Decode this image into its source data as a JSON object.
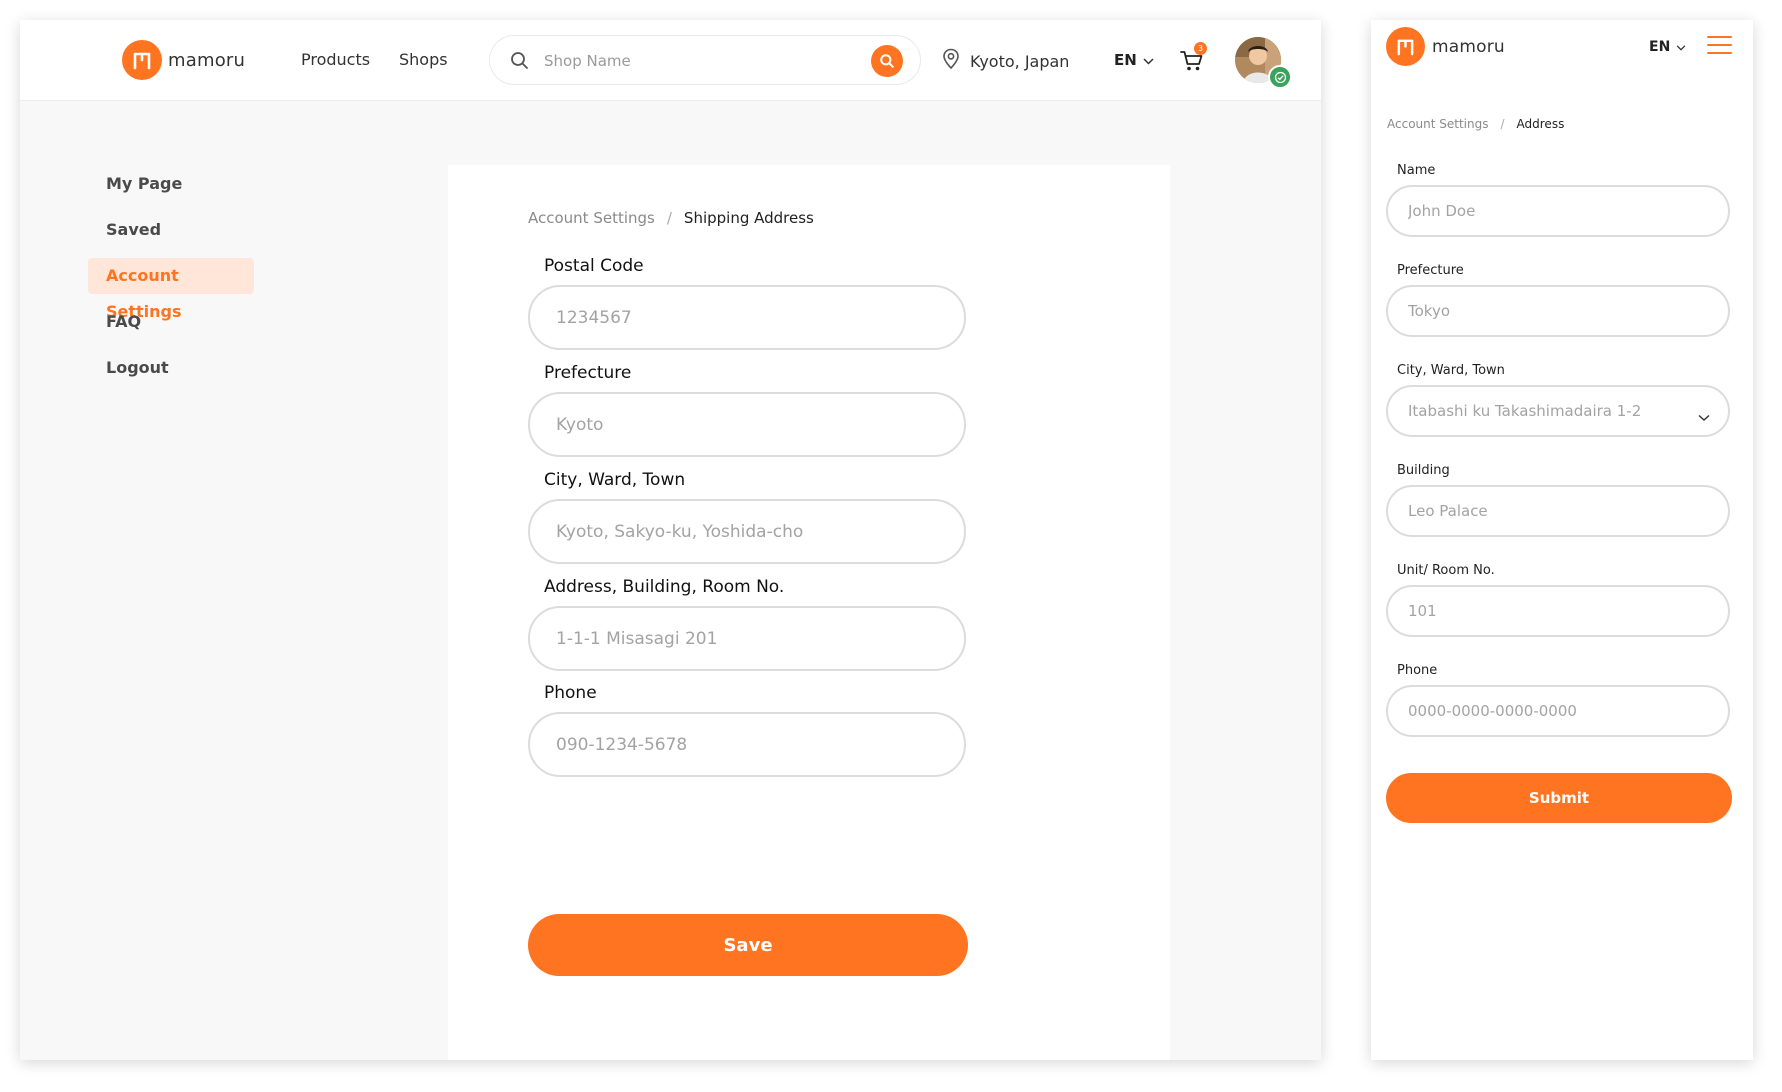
{
  "brand": {
    "name": "mamoru",
    "accent_color": "#ff7420",
    "logo_icon": "mamoru-logo-icon"
  },
  "desktop": {
    "header": {
      "nav": {
        "products": "Products",
        "shops": "Shops"
      },
      "search": {
        "placeholder": "Shop Name"
      },
      "location": "Kyoto, Japan",
      "language": "EN",
      "cart": {
        "count": "3"
      }
    },
    "sidebar": {
      "items": [
        {
          "label": "My Page"
        },
        {
          "label": "Saved"
        },
        {
          "label": "Account Settings",
          "active": true
        },
        {
          "label": "FAQ"
        },
        {
          "label": "Logout"
        }
      ]
    },
    "breadcrumb": {
      "parent": "Account Settings",
      "separator": "/",
      "current": "Shipping Address"
    },
    "form": {
      "postal": {
        "label": "Postal Code",
        "placeholder": "1234567"
      },
      "prefecture": {
        "label": "Prefecture",
        "placeholder": "Kyoto"
      },
      "city": {
        "label": "City, Ward, Town",
        "placeholder": "Kyoto, Sakyo-ku, Yoshida-cho"
      },
      "address": {
        "label": "Address, Building, Room No.",
        "placeholder": "1-1-1 Misasagi 201"
      },
      "phone": {
        "label": "Phone",
        "placeholder": "090-1234-5678"
      },
      "save_label": "Save"
    }
  },
  "mobile": {
    "header": {
      "language": "EN"
    },
    "breadcrumb": {
      "parent": "Account Settings",
      "separator": "/",
      "current": "Address"
    },
    "form": {
      "name": {
        "label": "Name",
        "placeholder": "John Doe"
      },
      "prefecture": {
        "label": "Prefecture",
        "placeholder": "Tokyo"
      },
      "city": {
        "label": "City, Ward, Town",
        "placeholder": "Itabashi ku Takashimadaira 1-2"
      },
      "building": {
        "label": "Building",
        "placeholder": "Leo Palace"
      },
      "unit": {
        "label": "Unit/ Room No.",
        "placeholder": "101"
      },
      "phone": {
        "label": "Phone",
        "placeholder": "0000-0000-0000-0000"
      },
      "submit_label": "Submit"
    }
  }
}
